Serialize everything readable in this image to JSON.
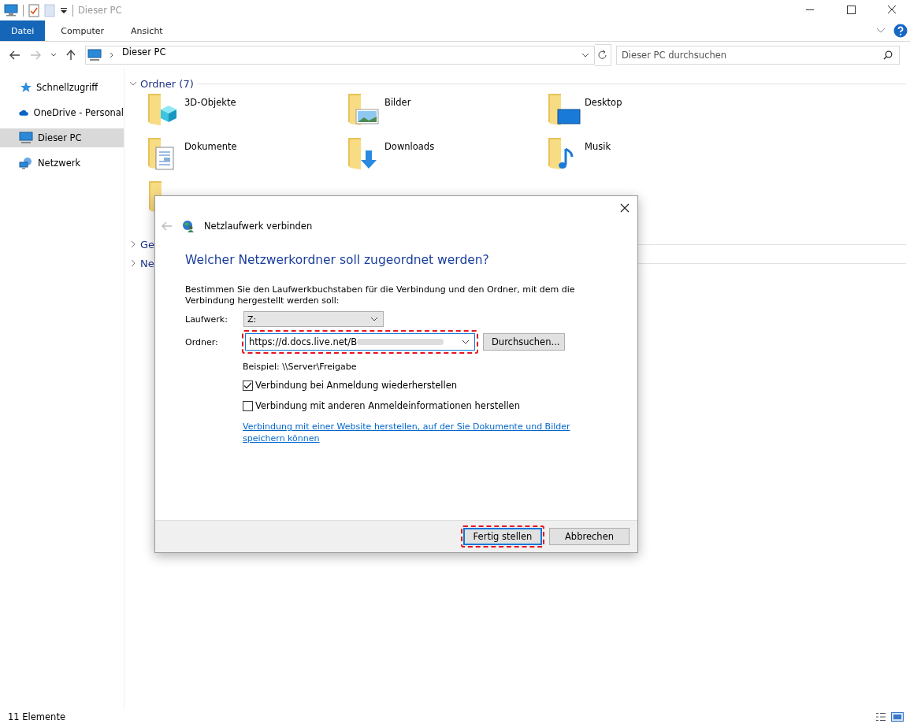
{
  "window": {
    "title": "Dieser PC"
  },
  "ribbon_tabs": [
    {
      "label": "Datei",
      "selected": true
    },
    {
      "label": "Computer",
      "selected": false
    },
    {
      "label": "Ansicht",
      "selected": false
    }
  ],
  "address_bar": {
    "path": "Dieser PC"
  },
  "search": {
    "placeholder": "Dieser PC durchsuchen"
  },
  "sidebar": {
    "items": [
      {
        "label": "Schnellzugriff",
        "kind": "star",
        "selected": false
      },
      {
        "label": "OneDrive - Personal",
        "kind": "cloud",
        "selected": false
      },
      {
        "label": "Dieser PC",
        "kind": "pc",
        "selected": true
      },
      {
        "label": "Netzwerk",
        "kind": "network",
        "selected": false
      }
    ]
  },
  "sections": [
    {
      "title": "Ordner (7)",
      "expanded": true,
      "folders": [
        {
          "name": "3D-Objekte",
          "kind": "cube"
        },
        {
          "name": "Bilder",
          "kind": "pictures"
        },
        {
          "name": "Desktop",
          "kind": "desktop"
        },
        {
          "name": "Dokumente",
          "kind": "documents"
        },
        {
          "name": "Downloads",
          "kind": "downloads"
        },
        {
          "name": "Musik",
          "kind": "music"
        },
        {
          "kind": "video"
        }
      ]
    },
    {
      "title": "Ge",
      "expanded": false
    },
    {
      "title": "Ne",
      "expanded": false
    }
  ],
  "dialog": {
    "title": "Netzlaufwerk verbinden",
    "heading": "Welcher Netzwerkordner soll zugeordnet werden?",
    "intro": "Bestimmen Sie den Laufwerkbuchstaben für die Verbindung und den Ordner, mit dem die Verbindung hergestellt werden soll:",
    "drive": {
      "label": "Laufwerk:",
      "value": "Z:"
    },
    "folder": {
      "label": "Ordner:",
      "value": "https://d.docs.live.net/B",
      "button": "Durchsuchen..."
    },
    "example": "Beispiel: \\\\Server\\Freigabe",
    "options": [
      {
        "label": "Verbindung bei Anmeldung wiederherstellen",
        "checked": true
      },
      {
        "label": "Verbindung mit anderen Anmeldeinformationen herstellen",
        "checked": false
      }
    ],
    "link": "Verbindung mit einer Website herstellen, auf der Sie Dokumente und Bilder speichern können",
    "buttons": [
      {
        "label": "Fertig stellen",
        "kind": "primary"
      },
      {
        "label": "Abbrechen",
        "kind": "secondary"
      }
    ]
  },
  "status_bar": {
    "count": "11 Elemente"
  }
}
